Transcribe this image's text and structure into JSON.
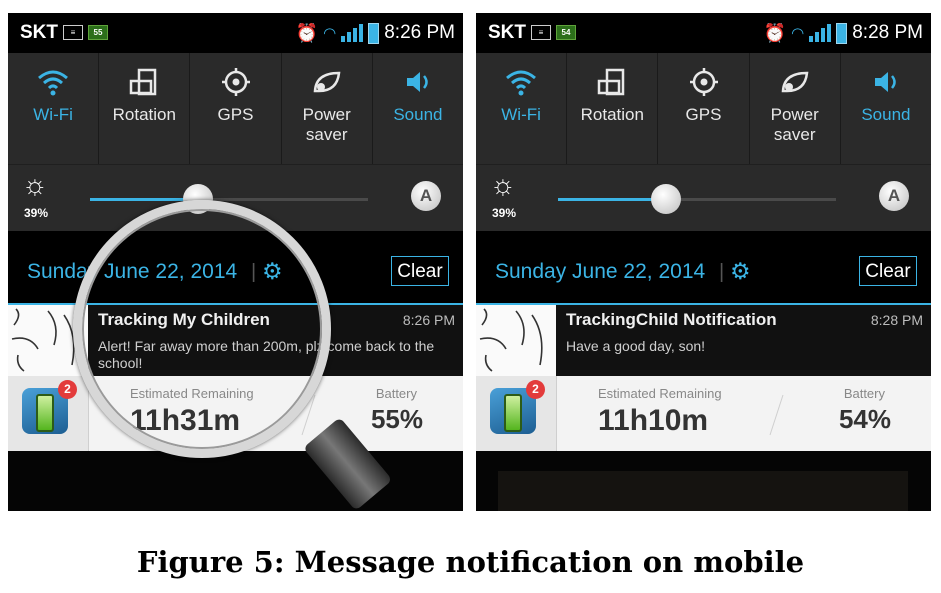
{
  "screens": [
    {
      "carrier": "SKT",
      "time": "8:26 PM",
      "network_badge": "55",
      "quick_settings": [
        "Wi-Fi",
        "Rotation",
        "GPS",
        "Power saver",
        "Sound"
      ],
      "brightness_pct": "39%",
      "brightness_level": 0.39,
      "auto_label": "A",
      "date": "Sunday June 22, 2014",
      "clear_label": "Clear",
      "notification": {
        "title": "Tracking My Children",
        "time": "8:26 PM",
        "body": "Alert! Far away more than 200m, plz come back to the school!"
      },
      "battery_widget": {
        "badge": "2",
        "est_label": "Estimated Remaining",
        "est_value": "11h31m",
        "battery_label": "Battery",
        "battery_value": "55%"
      }
    },
    {
      "carrier": "SKT",
      "time": "8:28 PM",
      "network_badge": "54",
      "quick_settings": [
        "Wi-Fi",
        "Rotation",
        "GPS",
        "Power saver",
        "Sound"
      ],
      "brightness_pct": "39%",
      "brightness_level": 0.39,
      "auto_label": "A",
      "date": "Sunday June 22, 2014",
      "clear_label": "Clear",
      "notification": {
        "title": "TrackingChild Notification",
        "time": "8:28 PM",
        "body": "Have a good day, son!"
      },
      "battery_widget": {
        "badge": "2",
        "est_label": "Estimated Remaining",
        "est_value": "11h10m",
        "battery_label": "Battery",
        "battery_value": "54%"
      }
    }
  ],
  "caption": "Figure 5: Message notification on mobile",
  "colors": {
    "accent": "#3bb4e5",
    "panel": "#2a2a2a"
  }
}
